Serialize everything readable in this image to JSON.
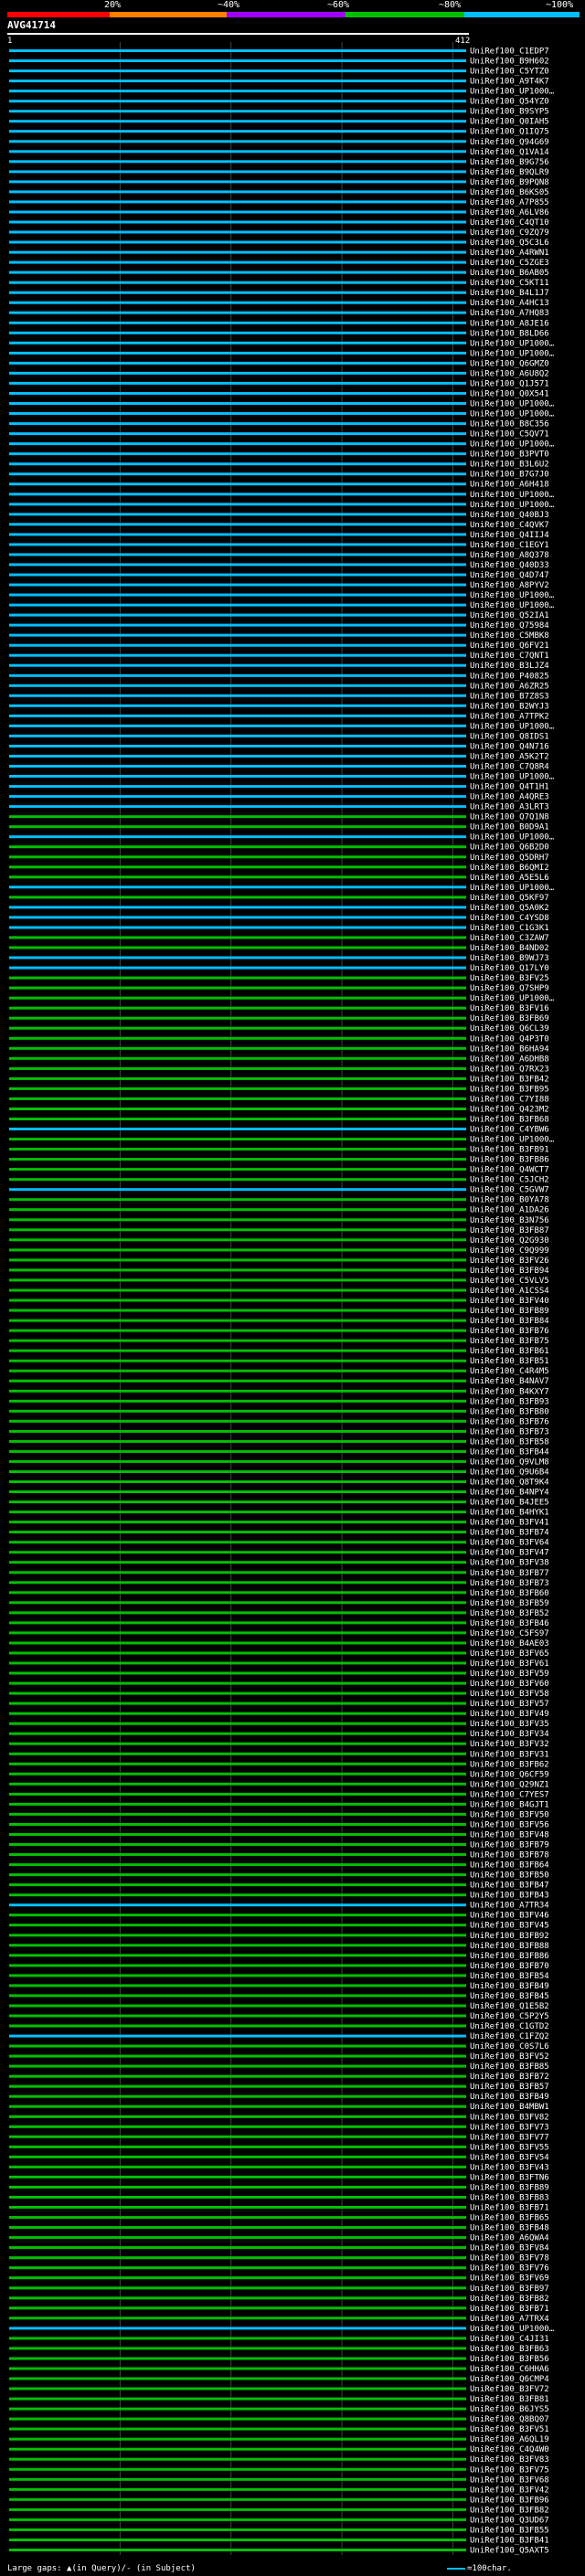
{
  "query": {
    "id": "AVG41714",
    "start": "1",
    "end": "412"
  },
  "scale": {
    "labels": [
      "20%",
      "~40%",
      "~60%",
      "~80%",
      "~100%"
    ],
    "colors": [
      "#ff0000",
      "#ff8000",
      "#a000ff",
      "#00c000",
      "#00bfff"
    ]
  },
  "legend": {
    "text": "Large gaps: ▲(in Query)/- (in Subject)",
    "key": "=100char."
  },
  "chart_data": {
    "type": "alignment",
    "query_length": 412,
    "hits": [
      {
        "name": "UniRef100_C1EDP7",
        "band": 4
      },
      {
        "name": "UniRef100_B9H602",
        "band": 4
      },
      {
        "name": "UniRef100_C5YTZ0",
        "band": 4
      },
      {
        "name": "UniRef100_A9T4K7",
        "band": 4
      },
      {
        "name": "UniRef100_UP1000…",
        "band": 4
      },
      {
        "name": "UniRef100_Q54YZ0",
        "band": 4
      },
      {
        "name": "UniRef100_B9SYP5",
        "band": 4
      },
      {
        "name": "UniRef100_Q0IAH5",
        "band": 4
      },
      {
        "name": "UniRef100_Q1IQ75",
        "band": 4
      },
      {
        "name": "UniRef100_Q94G69",
        "band": 4
      },
      {
        "name": "UniRef100_Q1VA14",
        "band": 4
      },
      {
        "name": "UniRef100_B9G756",
        "band": 4
      },
      {
        "name": "UniRef100_B9QLR9",
        "band": 4
      },
      {
        "name": "UniRef100_B9PQN8",
        "band": 4
      },
      {
        "name": "UniRef100_B6KS05",
        "band": 4
      },
      {
        "name": "UniRef100_A7P855",
        "band": 4
      },
      {
        "name": "UniRef100_A6LV86",
        "band": 4
      },
      {
        "name": "UniRef100_C4QT10",
        "band": 4
      },
      {
        "name": "UniRef100_C9ZQ79",
        "band": 4
      },
      {
        "name": "UniRef100_Q5C3L6",
        "band": 4
      },
      {
        "name": "UniRef100_A4RWN1",
        "band": 4
      },
      {
        "name": "UniRef100_C5ZGE3",
        "band": 4
      },
      {
        "name": "UniRef100_B6AB05",
        "band": 4
      },
      {
        "name": "UniRef100_C5KT11",
        "band": 4
      },
      {
        "name": "UniRef100_B4L1J7",
        "band": 4
      },
      {
        "name": "UniRef100_A4HC13",
        "band": 4
      },
      {
        "name": "UniRef100_A7HQ83",
        "band": 4
      },
      {
        "name": "UniRef100_A8JE16",
        "band": 4
      },
      {
        "name": "UniRef100_B8LD66",
        "band": 4
      },
      {
        "name": "UniRef100_UP1000…",
        "band": 4
      },
      {
        "name": "UniRef100_UP1000…",
        "band": 4
      },
      {
        "name": "UniRef100_Q6GMZ0",
        "band": 4
      },
      {
        "name": "UniRef100_A6U8Q2",
        "band": 4
      },
      {
        "name": "UniRef100_Q1J571",
        "band": 4
      },
      {
        "name": "UniRef100_Q0X541",
        "band": 4
      },
      {
        "name": "UniRef100_UP1000…",
        "band": 4
      },
      {
        "name": "UniRef100_UP1000…",
        "band": 4
      },
      {
        "name": "UniRef100_B8C356",
        "band": 4
      },
      {
        "name": "UniRef100_C5QV71",
        "band": 4
      },
      {
        "name": "UniRef100_UP1000…",
        "band": 4
      },
      {
        "name": "UniRef100_B3PVT0",
        "band": 4
      },
      {
        "name": "UniRef100_B3L6U2",
        "band": 4
      },
      {
        "name": "UniRef100_B7G7J0",
        "band": 4
      },
      {
        "name": "UniRef100_A6H418",
        "band": 4
      },
      {
        "name": "UniRef100_UP1000…",
        "band": 4
      },
      {
        "name": "UniRef100_UP1000…",
        "band": 4
      },
      {
        "name": "UniRef100_Q40BJ3",
        "band": 4
      },
      {
        "name": "UniRef100_C4QVK7",
        "band": 4
      },
      {
        "name": "UniRef100_Q4IIJ4",
        "band": 4
      },
      {
        "name": "UniRef100_C1EGY1",
        "band": 4
      },
      {
        "name": "UniRef100_A8Q378",
        "band": 4
      },
      {
        "name": "UniRef100_Q40D33",
        "band": 4
      },
      {
        "name": "UniRef100_Q4D747",
        "band": 4
      },
      {
        "name": "UniRef100_A8PYV2",
        "band": 4
      },
      {
        "name": "UniRef100_UP1000…",
        "band": 4
      },
      {
        "name": "UniRef100_UP1000…",
        "band": 4
      },
      {
        "name": "UniRef100_Q52IA1",
        "band": 4
      },
      {
        "name": "UniRef100_Q75984",
        "band": 4
      },
      {
        "name": "UniRef100_C5MBK8",
        "band": 4
      },
      {
        "name": "UniRef100_Q6FV21",
        "band": 4
      },
      {
        "name": "UniRef100_C7QNT1",
        "band": 4
      },
      {
        "name": "UniRef100_B3LJZ4",
        "band": 4
      },
      {
        "name": "UniRef100_P40825",
        "band": 4
      },
      {
        "name": "UniRef100_A6ZR25",
        "band": 4
      },
      {
        "name": "UniRef100_B7Z8S3",
        "band": 4
      },
      {
        "name": "UniRef100_B2WYJ3",
        "band": 4
      },
      {
        "name": "UniRef100_A7TPK2",
        "band": 4
      },
      {
        "name": "UniRef100_UP1000…",
        "band": 4
      },
      {
        "name": "UniRef100_Q8IDS1",
        "band": 4
      },
      {
        "name": "UniRef100_Q4N716",
        "band": 4
      },
      {
        "name": "UniRef100_A5K2T2",
        "band": 4
      },
      {
        "name": "UniRef100_C7Q8R4",
        "band": 4
      },
      {
        "name": "UniRef100_UP1000…",
        "band": 4
      },
      {
        "name": "UniRef100_Q4T1H1",
        "band": 4
      },
      {
        "name": "UniRef100_A4QRE3",
        "band": 4
      },
      {
        "name": "UniRef100_A3LRT3",
        "band": 4
      },
      {
        "name": "UniRef100_Q7Q1N8",
        "band": 3
      },
      {
        "name": "UniRef100_B0D9A1",
        "band": 3
      },
      {
        "name": "UniRef100_UP1000…",
        "band": 4
      },
      {
        "name": "UniRef100_Q6B2D0",
        "band": 3
      },
      {
        "name": "UniRef100_Q5DRH7",
        "band": 3
      },
      {
        "name": "UniRef100_B6QMI2",
        "band": 3
      },
      {
        "name": "UniRef100_A5E5L6",
        "band": 3
      },
      {
        "name": "UniRef100_UP1000…",
        "band": 4
      },
      {
        "name": "UniRef100_Q5KF97",
        "band": 3
      },
      {
        "name": "UniRef100_Q5A0K2",
        "band": 4
      },
      {
        "name": "UniRef100_C4YSD8",
        "band": 4
      },
      {
        "name": "UniRef100_C1G3K1",
        "band": 4
      },
      {
        "name": "UniRef100_C3ZAW7",
        "band": 3
      },
      {
        "name": "UniRef100_B4ND02",
        "band": 3
      },
      {
        "name": "UniRef100_B9WJ73",
        "band": 4
      },
      {
        "name": "UniRef100_Q17LY0",
        "band": 4
      },
      {
        "name": "UniRef100_B3FV25",
        "band": 3
      },
      {
        "name": "UniRef100_Q7SHP9",
        "band": 3
      },
      {
        "name": "UniRef100_UP1000…",
        "band": 3
      },
      {
        "name": "UniRef100_B3FV16",
        "band": 3
      },
      {
        "name": "UniRef100_B3FB69",
        "band": 3
      },
      {
        "name": "UniRef100_Q6CL39",
        "band": 3
      },
      {
        "name": "UniRef100_Q4P3T0",
        "band": 3
      },
      {
        "name": "UniRef100_B6HA94",
        "band": 3
      },
      {
        "name": "UniRef100_A6DHB8",
        "band": 3
      },
      {
        "name": "UniRef100_Q7RX23",
        "band": 3
      },
      {
        "name": "UniRef100_B3FB42",
        "band": 3
      },
      {
        "name": "UniRef100_B3FB95",
        "band": 3
      },
      {
        "name": "UniRef100_C7YI88",
        "band": 3
      },
      {
        "name": "UniRef100_Q423M2",
        "band": 3
      },
      {
        "name": "UniRef100_B3FB68",
        "band": 3
      },
      {
        "name": "UniRef100_C4YBW6",
        "band": 4
      },
      {
        "name": "UniRef100_UP1000…",
        "band": 3
      },
      {
        "name": "UniRef100_B3FB91",
        "band": 3
      },
      {
        "name": "UniRef100_B3FB86",
        "band": 3
      },
      {
        "name": "UniRef100_Q4WCT7",
        "band": 3
      },
      {
        "name": "UniRef100_C5JCH2",
        "band": 3
      },
      {
        "name": "UniRef100_C5GVW7",
        "band": 4
      },
      {
        "name": "UniRef100_B0YA78",
        "band": 3
      },
      {
        "name": "UniRef100_A1DA26",
        "band": 3
      },
      {
        "name": "UniRef100_B3N756",
        "band": 3
      },
      {
        "name": "UniRef100_B3FB87",
        "band": 3
      },
      {
        "name": "UniRef100_Q2G930",
        "band": 3
      },
      {
        "name": "UniRef100_C9Q999",
        "band": 3
      },
      {
        "name": "UniRef100_B3FV26",
        "band": 3
      },
      {
        "name": "UniRef100_B3FB94",
        "band": 3
      },
      {
        "name": "UniRef100_C5VLV5",
        "band": 3
      },
      {
        "name": "UniRef100_A1CSS4",
        "band": 3
      },
      {
        "name": "UniRef100_B3FV40",
        "band": 3
      },
      {
        "name": "UniRef100_B3FB89",
        "band": 3
      },
      {
        "name": "UniRef100_B3FB84",
        "band": 3
      },
      {
        "name": "UniRef100_B3FB76",
        "band": 3
      },
      {
        "name": "UniRef100_B3FB75",
        "band": 3
      },
      {
        "name": "UniRef100_B3FB61",
        "band": 3
      },
      {
        "name": "UniRef100_B3FB51",
        "band": 3
      },
      {
        "name": "UniRef100_C4R4M5",
        "band": 3
      },
      {
        "name": "UniRef100_B4NAV7",
        "band": 3
      },
      {
        "name": "UniRef100_B4KXY7",
        "band": 3
      },
      {
        "name": "UniRef100_B3FB93",
        "band": 3
      },
      {
        "name": "UniRef100_B3FB80",
        "band": 3
      },
      {
        "name": "UniRef100_B3FB76",
        "band": 3
      },
      {
        "name": "UniRef100_B3FB73",
        "band": 3
      },
      {
        "name": "UniRef100_B3FB58",
        "band": 3
      },
      {
        "name": "UniRef100_B3FB44",
        "band": 3
      },
      {
        "name": "UniRef100_Q9VLM8",
        "band": 3
      },
      {
        "name": "UniRef100_Q9U6B4",
        "band": 3
      },
      {
        "name": "UniRef100_Q8T9K4",
        "band": 3
      },
      {
        "name": "UniRef100_B4NPY4",
        "band": 3
      },
      {
        "name": "UniRef100_B4JEE5",
        "band": 3
      },
      {
        "name": "UniRef100_B4HYK1",
        "band": 3
      },
      {
        "name": "UniRef100_B3FV41",
        "band": 3
      },
      {
        "name": "UniRef100_B3FB74",
        "band": 3
      },
      {
        "name": "UniRef100_B3FV64",
        "band": 3
      },
      {
        "name": "UniRef100_B3FV47",
        "band": 3
      },
      {
        "name": "UniRef100_B3FV38",
        "band": 3
      },
      {
        "name": "UniRef100_B3FB77",
        "band": 3
      },
      {
        "name": "UniRef100_B3FB73",
        "band": 3
      },
      {
        "name": "UniRef100_B3FB60",
        "band": 3
      },
      {
        "name": "UniRef100_B3FB59",
        "band": 3
      },
      {
        "name": "UniRef100_B3FB52",
        "band": 3
      },
      {
        "name": "UniRef100_B3FB46",
        "band": 3
      },
      {
        "name": "UniRef100_C5FS97",
        "band": 3
      },
      {
        "name": "UniRef100_B4AE03",
        "band": 3
      },
      {
        "name": "UniRef100_B3FV65",
        "band": 3
      },
      {
        "name": "UniRef100_B3FV61",
        "band": 3
      },
      {
        "name": "UniRef100_B3FV59",
        "band": 3
      },
      {
        "name": "UniRef100_B3FV60",
        "band": 3
      },
      {
        "name": "UniRef100_B3FV58",
        "band": 3
      },
      {
        "name": "UniRef100_B3FV57",
        "band": 3
      },
      {
        "name": "UniRef100_B3FV49",
        "band": 3
      },
      {
        "name": "UniRef100_B3FV35",
        "band": 3
      },
      {
        "name": "UniRef100_B3FV34",
        "band": 3
      },
      {
        "name": "UniRef100_B3FV32",
        "band": 3
      },
      {
        "name": "UniRef100_B3FV31",
        "band": 3
      },
      {
        "name": "UniRef100_B3FB62",
        "band": 3
      },
      {
        "name": "UniRef100_Q6CF59",
        "band": 3
      },
      {
        "name": "UniRef100_Q29NZ1",
        "band": 3
      },
      {
        "name": "UniRef100_C7YES7",
        "band": 3
      },
      {
        "name": "UniRef100_B4GJT1",
        "band": 3
      },
      {
        "name": "UniRef100_B3FV50",
        "band": 3
      },
      {
        "name": "UniRef100_B3FV56",
        "band": 3
      },
      {
        "name": "UniRef100_B3FV48",
        "band": 3
      },
      {
        "name": "UniRef100_B3FB79",
        "band": 3
      },
      {
        "name": "UniRef100_B3FB78",
        "band": 3
      },
      {
        "name": "UniRef100_B3FB64",
        "band": 3
      },
      {
        "name": "UniRef100_B3FB50",
        "band": 3
      },
      {
        "name": "UniRef100_B3FB47",
        "band": 3
      },
      {
        "name": "UniRef100_B3FB43",
        "band": 3
      },
      {
        "name": "UniRef100_A7TR34",
        "band": 4
      },
      {
        "name": "UniRef100_B3FV46",
        "band": 3
      },
      {
        "name": "UniRef100_B3FV45",
        "band": 3
      },
      {
        "name": "UniRef100_B3FB92",
        "band": 3
      },
      {
        "name": "UniRef100_B3FB88",
        "band": 3
      },
      {
        "name": "UniRef100_B3FB86",
        "band": 3
      },
      {
        "name": "UniRef100_B3FB70",
        "band": 3
      },
      {
        "name": "UniRef100_B3FB54",
        "band": 3
      },
      {
        "name": "UniRef100_B3FB49",
        "band": 3
      },
      {
        "name": "UniRef100_B3FB45",
        "band": 3
      },
      {
        "name": "UniRef100_Q1E5B2",
        "band": 3
      },
      {
        "name": "UniRef100_C5P2Y5",
        "band": 3
      },
      {
        "name": "UniRef100_C1GTD2",
        "band": 3
      },
      {
        "name": "UniRef100_C1FZQ2",
        "band": 4
      },
      {
        "name": "UniRef100_C0S7L6",
        "band": 3
      },
      {
        "name": "UniRef100_B3FV52",
        "band": 3
      },
      {
        "name": "UniRef100_B3FB85",
        "band": 3
      },
      {
        "name": "UniRef100_B3FB72",
        "band": 3
      },
      {
        "name": "UniRef100_B3FB57",
        "band": 3
      },
      {
        "name": "UniRef100_B3FB49",
        "band": 3
      },
      {
        "name": "UniRef100_B4MBW1",
        "band": 3
      },
      {
        "name": "UniRef100_B3FV82",
        "band": 3
      },
      {
        "name": "UniRef100_B3FV73",
        "band": 3
      },
      {
        "name": "UniRef100_B3FV77",
        "band": 3
      },
      {
        "name": "UniRef100_B3FV55",
        "band": 3
      },
      {
        "name": "UniRef100_B3FV54",
        "band": 3
      },
      {
        "name": "UniRef100_B3FV43",
        "band": 3
      },
      {
        "name": "UniRef100_B3FTN6",
        "band": 3
      },
      {
        "name": "UniRef100_B3FB89",
        "band": 3
      },
      {
        "name": "UniRef100_B3FB83",
        "band": 3
      },
      {
        "name": "UniRef100_B3FB71",
        "band": 3
      },
      {
        "name": "UniRef100_B3FB65",
        "band": 3
      },
      {
        "name": "UniRef100_B3FB48",
        "band": 3
      },
      {
        "name": "UniRef100_A6QWA4",
        "band": 3
      },
      {
        "name": "UniRef100_B3FV84",
        "band": 3
      },
      {
        "name": "UniRef100_B3FV78",
        "band": 3
      },
      {
        "name": "UniRef100_B3FV76",
        "band": 3
      },
      {
        "name": "UniRef100_B3FV69",
        "band": 3
      },
      {
        "name": "UniRef100_B3FB97",
        "band": 3
      },
      {
        "name": "UniRef100_B3FB82",
        "band": 3
      },
      {
        "name": "UniRef100_B3FB71",
        "band": 3
      },
      {
        "name": "UniRef100_A7TRX4",
        "band": 3
      },
      {
        "name": "UniRef100_UP1000…",
        "band": 4
      },
      {
        "name": "UniRef100_C4JI31",
        "band": 3
      },
      {
        "name": "UniRef100_B3FB63",
        "band": 3
      },
      {
        "name": "UniRef100_B3FB56",
        "band": 3
      },
      {
        "name": "UniRef100_C6HHA6",
        "band": 3
      },
      {
        "name": "UniRef100_Q6CMP4",
        "band": 3
      },
      {
        "name": "UniRef100_B3FV72",
        "band": 3
      },
      {
        "name": "UniRef100_B3FB81",
        "band": 3
      },
      {
        "name": "UniRef100_B6JYS5",
        "band": 3
      },
      {
        "name": "UniRef100_Q8BQ07",
        "band": 3
      },
      {
        "name": "UniRef100_B3FV51",
        "band": 3
      },
      {
        "name": "UniRef100_A6QL19",
        "band": 3
      },
      {
        "name": "UniRef100_C4Q4W0",
        "band": 3
      },
      {
        "name": "UniRef100_B3FV83",
        "band": 3
      },
      {
        "name": "UniRef100_B3FV75",
        "band": 3
      },
      {
        "name": "UniRef100_B3FV68",
        "band": 3
      },
      {
        "name": "UniRef100_B3FV42",
        "band": 3
      },
      {
        "name": "UniRef100_B3FB96",
        "band": 3
      },
      {
        "name": "UniRef100_B3FB82",
        "band": 3
      },
      {
        "name": "UniRef100_Q3UD67",
        "band": 3
      },
      {
        "name": "UniRef100_B3FB55",
        "band": 3
      },
      {
        "name": "UniRef100_B3FB41",
        "band": 3
      },
      {
        "name": "UniRef100_Q5AXT5",
        "band": 3
      }
    ]
  }
}
